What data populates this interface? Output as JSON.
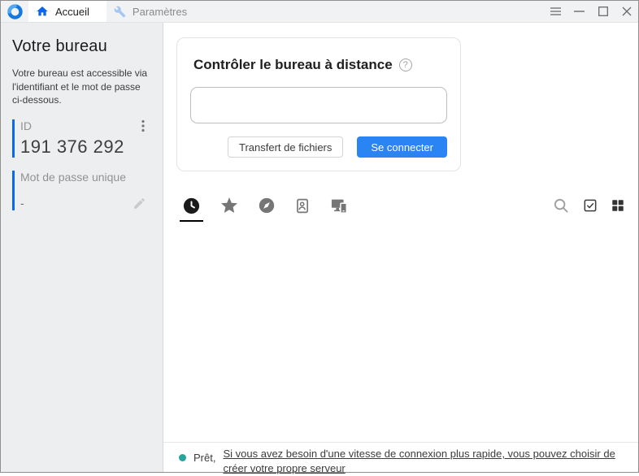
{
  "titlebar": {
    "tabs": [
      {
        "label": "Accueil"
      },
      {
        "label": "Paramètres"
      }
    ]
  },
  "sidebar": {
    "title": "Votre bureau",
    "description": "Votre bureau est accessible via l'identifiant et le mot de passe ci-dessous.",
    "id_label": "ID",
    "id_value": "191 376 292",
    "password_label": "Mot de passe unique",
    "password_value": "-"
  },
  "connect_card": {
    "title": "Contrôler le bureau à distance",
    "input_value": "",
    "transfer_button": "Transfert de fichiers",
    "connect_button": "Se connecter"
  },
  "statusbar": {
    "status": "Prêt,",
    "link": "Si vous avez besoin d'une vitesse de connexion plus rapide, vous pouvez choisir de créer votre propre serveur"
  },
  "icons": {
    "help_glyph": "?",
    "tab_icons": [
      "recent-sessions",
      "favorites",
      "discovered",
      "address-book",
      "devices"
    ],
    "right_icons": [
      "search",
      "select-peers",
      "grid-view"
    ]
  },
  "colors": {
    "accent_blue": "#0a68f5",
    "home_icon_blue": "#0b63f2",
    "connect_button_blue": "#2b84f4",
    "status_green": "#26a69a",
    "sidebar_bg": "#edeef0",
    "titlebar_bg": "#f1f2f4"
  }
}
